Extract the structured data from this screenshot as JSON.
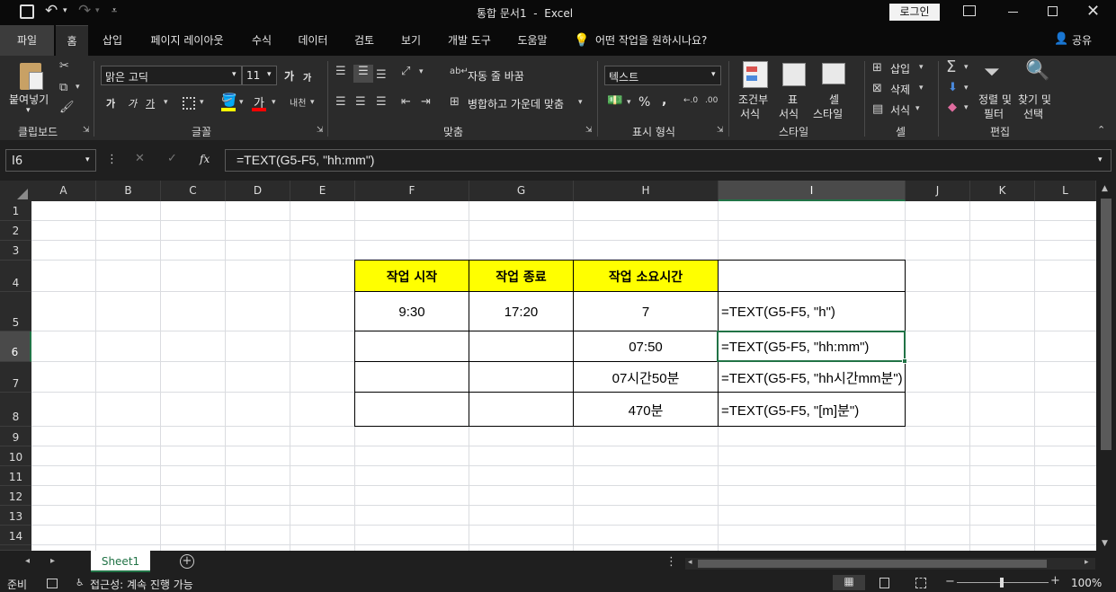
{
  "title": {
    "doc": "통합 문서1",
    "sep": "-",
    "app": "Excel",
    "login": "로그인"
  },
  "tabs": [
    "파일",
    "홈",
    "삽입",
    "페이지 레이아웃",
    "수식",
    "데이터",
    "검토",
    "보기",
    "개발 도구",
    "도움말"
  ],
  "tell_me": "어떤 작업을 원하시나요?",
  "share": "공유",
  "ribbon": {
    "paste": "붙여넣기",
    "clipboard": "클립보드",
    "font_name": "맑은 고딕",
    "font_size": "11",
    "font_group": "글꼴",
    "bold": "가",
    "italic": "가",
    "underline": "가",
    "grow": "가",
    "shrink": "가",
    "font_color_glyph": "가",
    "wrap": "자동 줄 바꿈",
    "merge": "병합하고 가운데 맞춤",
    "align_group": "맞춤",
    "number_format": "텍스트",
    "percent": "%",
    "comma": ",",
    "number_group": "표시 형식",
    "cond_format": "조건부",
    "cond_format2": "서식",
    "table_format": "표",
    "table_format2": "서식",
    "cell_style": "셀",
    "cell_style2": "스타일",
    "style_group": "스타일",
    "insert": "삽입",
    "delete": "삭제",
    "format": "서식",
    "cells_group": "셀",
    "sort": "정렬 및",
    "sort2": "필터",
    "find": "찾기 및",
    "find2": "선택",
    "edit_group": "편집"
  },
  "formula_bar": {
    "name_box": "I6",
    "fx": "fx",
    "formula": "=TEXT(G5-F5, \"hh:mm\")"
  },
  "columns": [
    "A",
    "B",
    "C",
    "D",
    "E",
    "F",
    "G",
    "H",
    "I",
    "J",
    "K",
    "L"
  ],
  "rows": [
    "1",
    "2",
    "3",
    "4",
    "5",
    "6",
    "7",
    "8",
    "9",
    "10",
    "11",
    "12",
    "13",
    "14"
  ],
  "table": {
    "headers": [
      "작업 시작",
      "작업 종료",
      "작업 소요시간",
      ""
    ],
    "f5": "9:30",
    "g5": "17:20",
    "h": [
      "7",
      "07:50",
      "07시간50분",
      "470분"
    ],
    "i": [
      "=TEXT(G5-F5, \"h\")",
      "=TEXT(G5-F5, \"hh:mm\")",
      "=TEXT(G5-F5, \"hh시간mm분\")",
      "=TEXT(G5-F5, \"[m]분\")"
    ]
  },
  "sheet": "Sheet1",
  "status": {
    "ready": "준비",
    "accessibility": "접근성: 계속 진행 가능",
    "zoom": "100%"
  },
  "colors": {
    "header_fill": "#ffff00",
    "excel_green": "#217346",
    "ribbon_bg": "#2b2b2b"
  }
}
